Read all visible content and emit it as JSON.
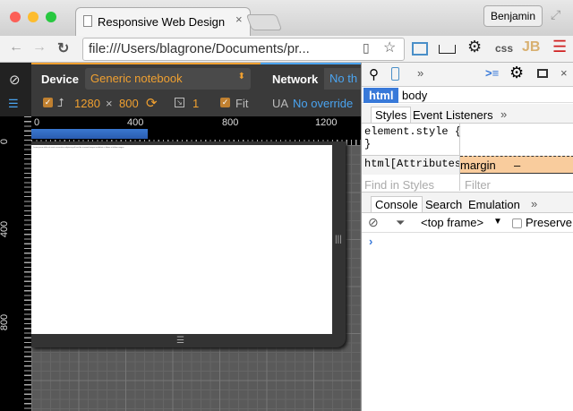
{
  "browser": {
    "tab_title": "Responsive Web Design",
    "user": "Benjamin",
    "url": "file:///Users/blagrone/Documents/pr...",
    "ext_css": "css",
    "ext_jb": "JB"
  },
  "emulation": {
    "device_label": "Device",
    "device_value": "Generic notebook",
    "network_label": "Network",
    "network_value": "No th",
    "width": "1280",
    "times": "×",
    "height": "800",
    "dpr": "1",
    "fit": "Fit",
    "ua_label": "UA",
    "ua_value": "No override"
  },
  "ruler": {
    "h": [
      "0",
      "400",
      "800",
      "1200"
    ],
    "v": [
      "0",
      "400",
      "800"
    ]
  },
  "page_text": "Lorem ipsum dolor sit amet consectetur adipiscing elit sed do eiusmod tempor incididunt ut labore et dolore magna",
  "devtools": {
    "breadcrumbs": [
      "html",
      "body"
    ],
    "styles_tabs": [
      "Styles",
      "Event Listeners",
      "»"
    ],
    "rule1": "element.style {",
    "rule1_close": "}",
    "rule2": "html[Attributes Style] {",
    "box_label": "margin",
    "box_value": "–",
    "find_placeholder": "Find in Styles",
    "filter_placeholder": "Filter",
    "drawer_tabs": [
      "Console",
      "Search",
      "Emulation",
      "»"
    ],
    "frame": "<top frame>",
    "preserve": "Preserve",
    "prompt": "›",
    "more": "»"
  },
  "colors": {
    "accent": "#f0a030",
    "link": "#4aa4f0",
    "selected": "#3879d9"
  }
}
